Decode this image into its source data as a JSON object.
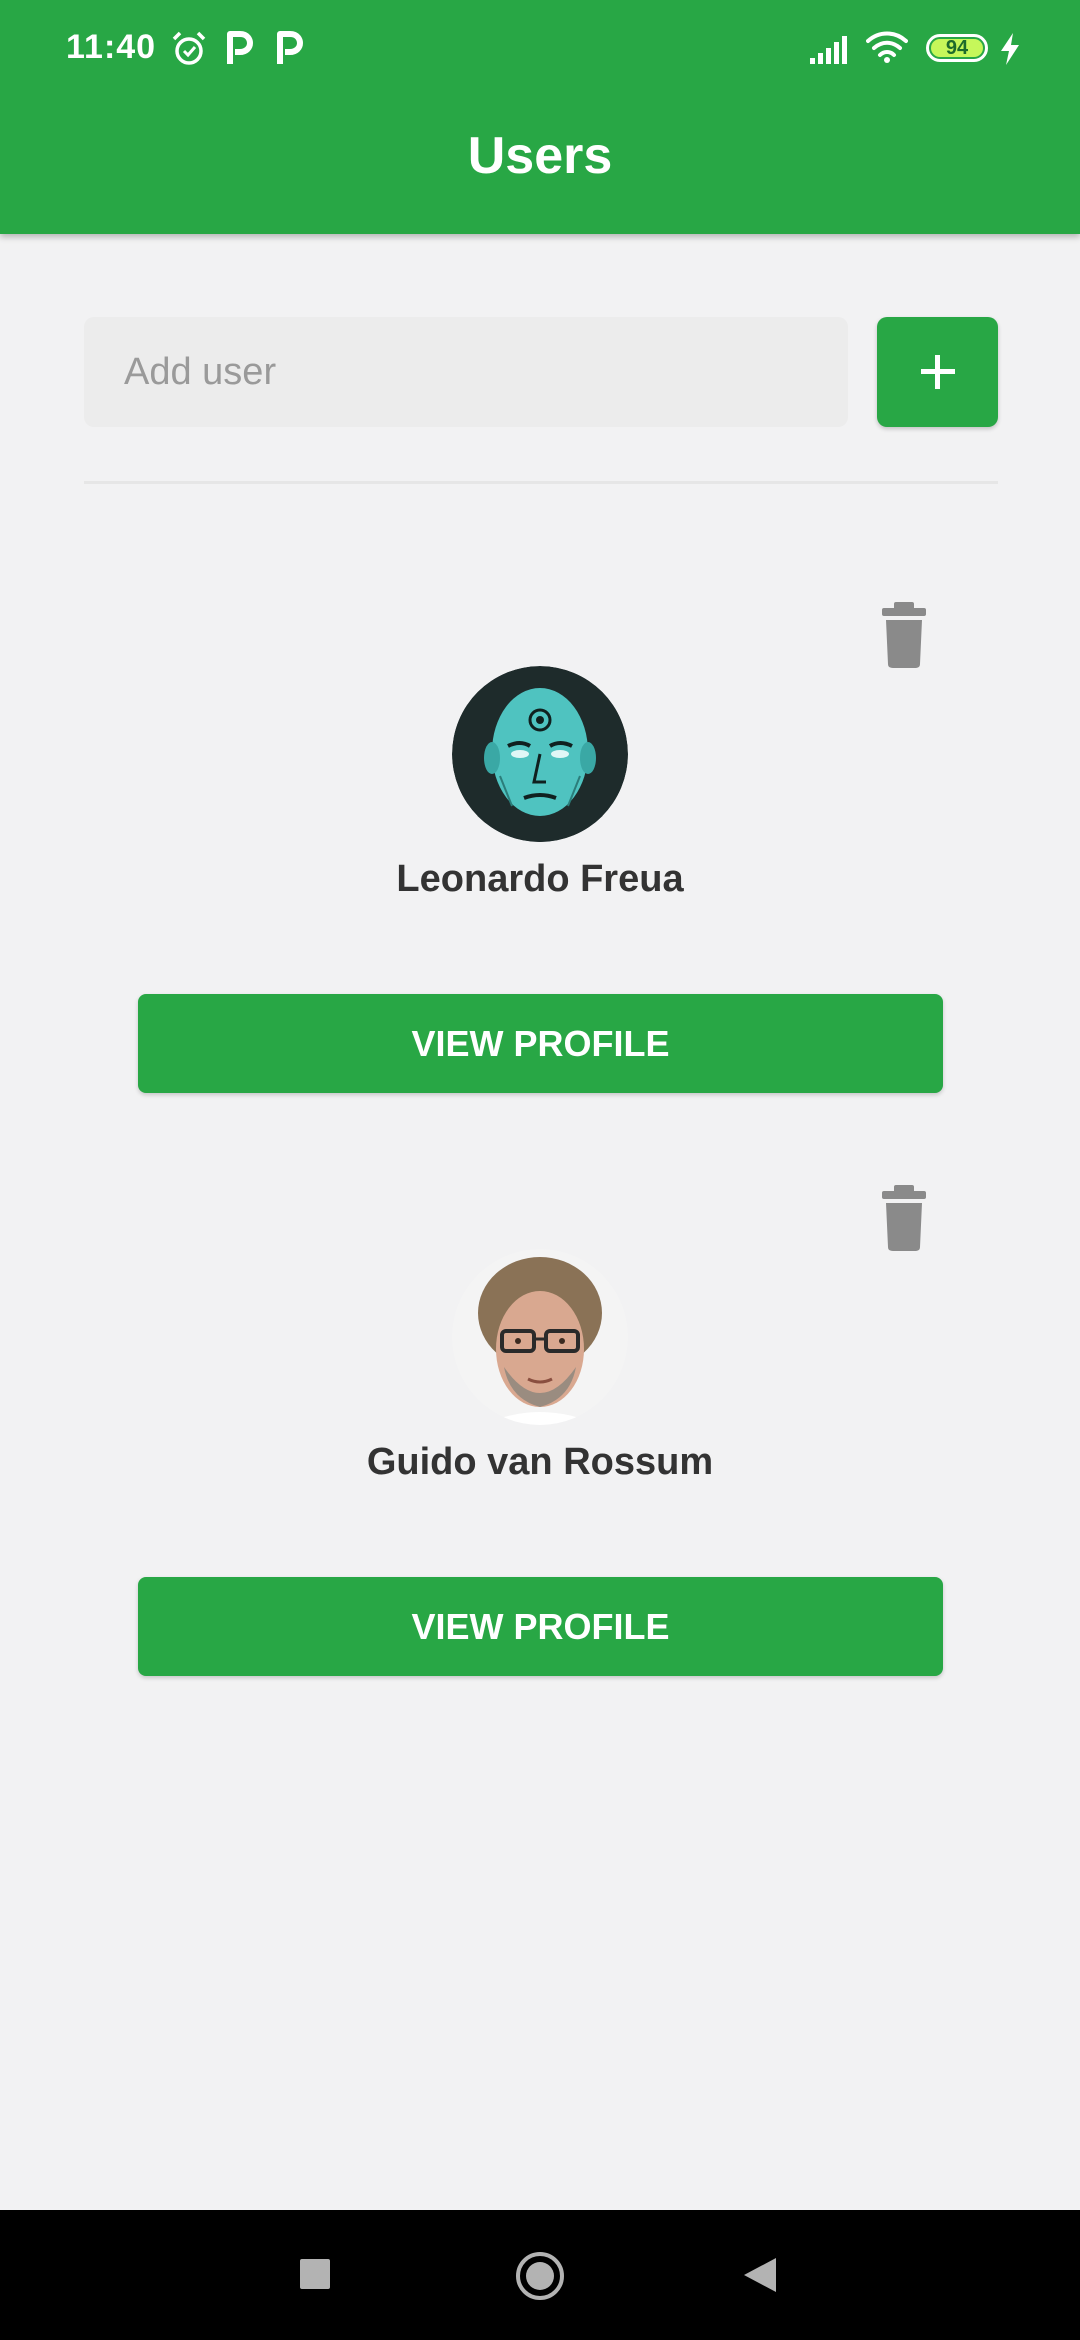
{
  "status_bar": {
    "time": "11:40",
    "battery_level": "94",
    "icons": [
      "alarm-icon",
      "parking-icon",
      "parking-icon",
      "signal-icon",
      "wifi-icon",
      "battery-icon",
      "charging-icon"
    ]
  },
  "app_bar": {
    "title": "Users"
  },
  "add_user": {
    "placeholder": "Add user",
    "value": "",
    "button_icon": "plus-icon"
  },
  "users": [
    {
      "name": "Leonardo Freua",
      "avatar": "illustrated-face-avatar",
      "button_label": "VIEW PROFILE",
      "delete_icon": "trash-icon"
    },
    {
      "name": "Guido van Rossum",
      "avatar": "photo-face-avatar",
      "button_label": "VIEW PROFILE",
      "delete_icon": "trash-icon"
    }
  ],
  "nav_bar": {
    "buttons": [
      "recents-square-icon",
      "home-circle-icon",
      "back-triangle-icon"
    ]
  },
  "colors": {
    "primary": "#28a745",
    "background": "#f2f2f3",
    "text": "#333333",
    "icon_grey": "#8a8a8a"
  }
}
